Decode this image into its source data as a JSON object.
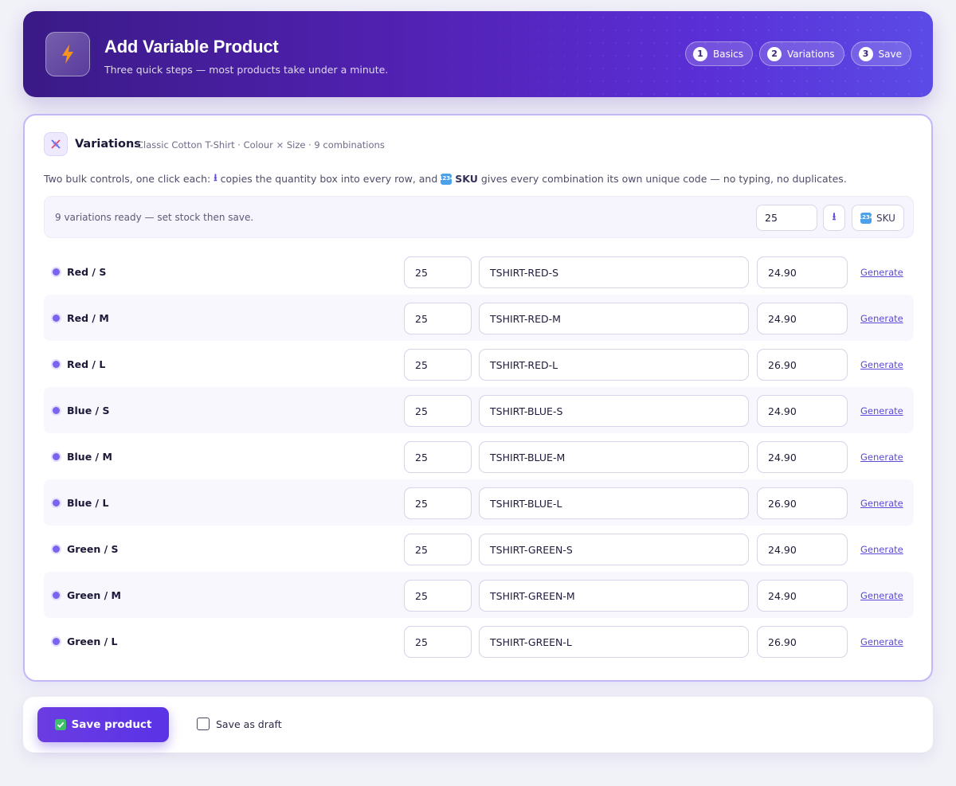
{
  "header": {
    "title": "Add Variable Product",
    "subtitle": "Three quick steps — most products take under a minute.",
    "logo_icon": "lightning-bolt-icon",
    "steps": [
      {
        "num": "1",
        "label": "Basics"
      },
      {
        "num": "2",
        "label": "Variations"
      },
      {
        "num": "3",
        "label": "Save"
      }
    ]
  },
  "variations": {
    "title": "Variations",
    "meta": "Classic Cotton T-Shirt · Colour × Size · 9 combinations",
    "hint_prefix": "Two bulk controls, one click each:",
    "hint_arrow": "⭳",
    "hint_mid": "copies the quantity box into every row, and",
    "hint_sku_badge": "1234",
    "hint_sku": "SKU",
    "hint_suffix": "gives every combination its own unique code — no typing, no duplicates.",
    "bulk": {
      "status": "9 variations ready — set stock then save.",
      "quantity": "25",
      "copy_glyph": "⭳",
      "sku_badge": "1234",
      "sku_label": "SKU"
    },
    "generate_label": "Generate",
    "rows": [
      {
        "label": "Red / S",
        "qty": "25",
        "sku": "TSHIRT-RED-S",
        "price": "24.90"
      },
      {
        "label": "Red / M",
        "qty": "25",
        "sku": "TSHIRT-RED-M",
        "price": "24.90"
      },
      {
        "label": "Red / L",
        "qty": "25",
        "sku": "TSHIRT-RED-L",
        "price": "26.90"
      },
      {
        "label": "Blue / S",
        "qty": "25",
        "sku": "TSHIRT-BLUE-S",
        "price": "24.90"
      },
      {
        "label": "Blue / M",
        "qty": "25",
        "sku": "TSHIRT-BLUE-M",
        "price": "24.90"
      },
      {
        "label": "Blue / L",
        "qty": "25",
        "sku": "TSHIRT-BLUE-L",
        "price": "26.90"
      },
      {
        "label": "Green / S",
        "qty": "25",
        "sku": "TSHIRT-GREEN-S",
        "price": "24.90"
      },
      {
        "label": "Green / M",
        "qty": "25",
        "sku": "TSHIRT-GREEN-M",
        "price": "24.90"
      },
      {
        "label": "Green / L",
        "qty": "25",
        "sku": "TSHIRT-GREEN-L",
        "price": "26.90"
      }
    ]
  },
  "footer": {
    "save_label": "Save product",
    "draft_label": "Save as draft",
    "draft_checked": false
  },
  "colors": {
    "accent": "#5b4bd6",
    "header_start": "#3a1a86",
    "header_end": "#5b4be6",
    "card_border": "#c3b7f8",
    "bolt": "#f7931e"
  }
}
